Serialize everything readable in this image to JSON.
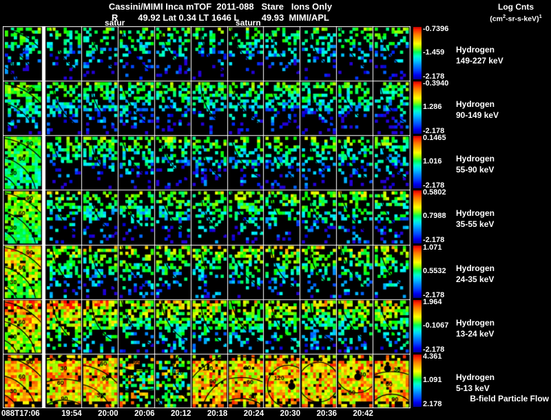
{
  "header": {
    "title": "Cassini/MIMI Inca mTOF  2011-088   Stare   Ions Only",
    "subtitle": "R        49.92 Lat 0.34 LT 1646 L         49.93  MIMI/APL",
    "units_title": "Log Cnts",
    "units": {
      "p1": "(cm",
      "s1": "2",
      "p2": "-sr-s-keV)",
      "s2": "1"
    }
  },
  "annotations": [
    "satur",
    "saturn"
  ],
  "rows": [
    {
      "species": "Hydrogen",
      "energy": "149-227 keV",
      "cbar_top": "-0.7396",
      "cbar_mid": "-1.459",
      "cbar_bot": "-2.178"
    },
    {
      "species": "Hydrogen",
      "energy": "90-149 keV",
      "cbar_top": "-0.3940",
      "cbar_mid": "1.286",
      "cbar_bot": "-2.178"
    },
    {
      "species": "Hydrogen",
      "energy": "55-90 keV",
      "cbar_top": "0.1465",
      "cbar_mid": "1.016",
      "cbar_bot": "-2.178"
    },
    {
      "species": "Hydrogen",
      "energy": "35-55 keV",
      "cbar_top": "0.5802",
      "cbar_mid": "0.7988",
      "cbar_bot": "-2.178"
    },
    {
      "species": "Hydrogen",
      "energy": "24-35 keV",
      "cbar_top": "1.071",
      "cbar_mid": "0.5532",
      "cbar_bot": "-2.178"
    },
    {
      "species": "Hydrogen",
      "energy": "13-24 keV",
      "cbar_top": "1.964",
      "cbar_mid": "-0.1067",
      "cbar_bot": "-2.178"
    },
    {
      "species": "Hydrogen",
      "energy": "5-13 keV",
      "cbar_top": "4.361",
      "cbar_mid": "1.091",
      "cbar_bot": "2.178",
      "extra": "B-field Particle Flow"
    }
  ],
  "time_axis": [
    "088T17:06",
    "19:54",
    "20:00",
    "20:06",
    "20:12",
    "20:18",
    "20:24",
    "20:30",
    "20:36",
    "20:42"
  ],
  "contour_labels": [
    "30",
    "60",
    "90",
    "120"
  ],
  "colors": {
    "background": "#000000",
    "text": "#ffffff",
    "grid": "#ffffff",
    "contour": "#000000"
  },
  "chart_data": {
    "type": "heatmap",
    "title": "Cassini/MIMI Inca mTOF 2011-088 Stare Ions Only",
    "instrument": "MIMI/APL",
    "geometry": {
      "R": "49.92",
      "Lat": "0.34",
      "LT": "1646",
      "L": "49.93"
    },
    "colorbar_units": "Log Cnts (cm2-sr-s-keV)1",
    "columns_times": [
      "088T17:06",
      "19:54",
      "20:00",
      "20:06",
      "20:12",
      "20:18",
      "20:24",
      "20:30",
      "20:36",
      "20:42"
    ],
    "n_tile_columns": 11,
    "rows": [
      {
        "species": "Hydrogen",
        "energy_kev": "149-227",
        "scale": {
          "max": "-0.7396",
          "mid": "-1.459",
          "min": "-2.178"
        }
      },
      {
        "species": "Hydrogen",
        "energy_kev": "90-149",
        "scale": {
          "max": "-0.3940",
          "mid": "1.286",
          "min": "-2.178"
        }
      },
      {
        "species": "Hydrogen",
        "energy_kev": "55-90",
        "scale": {
          "max": "0.1465",
          "mid": "1.016",
          "min": "-2.178"
        }
      },
      {
        "species": "Hydrogen",
        "energy_kev": "35-55",
        "scale": {
          "max": "0.5802",
          "mid": "0.7988",
          "min": "-2.178"
        }
      },
      {
        "species": "Hydrogen",
        "energy_kev": "24-35",
        "scale": {
          "max": "1.071",
          "mid": "0.5532",
          "min": "-2.178"
        }
      },
      {
        "species": "Hydrogen",
        "energy_kev": "13-24",
        "scale": {
          "max": "1.964",
          "mid": "-0.1067",
          "min": "-2.178"
        }
      },
      {
        "species": "Hydrogen",
        "energy_kev": "5-13",
        "scale": {
          "max": "4.361",
          "mid": "1.091",
          "min": "2.178"
        },
        "note": "B-field Particle Flow"
      }
    ],
    "contour_values_deg": [
      30,
      60,
      90,
      120
    ],
    "annotations": [
      "satur",
      "saturn"
    ],
    "legend_position": "right"
  }
}
